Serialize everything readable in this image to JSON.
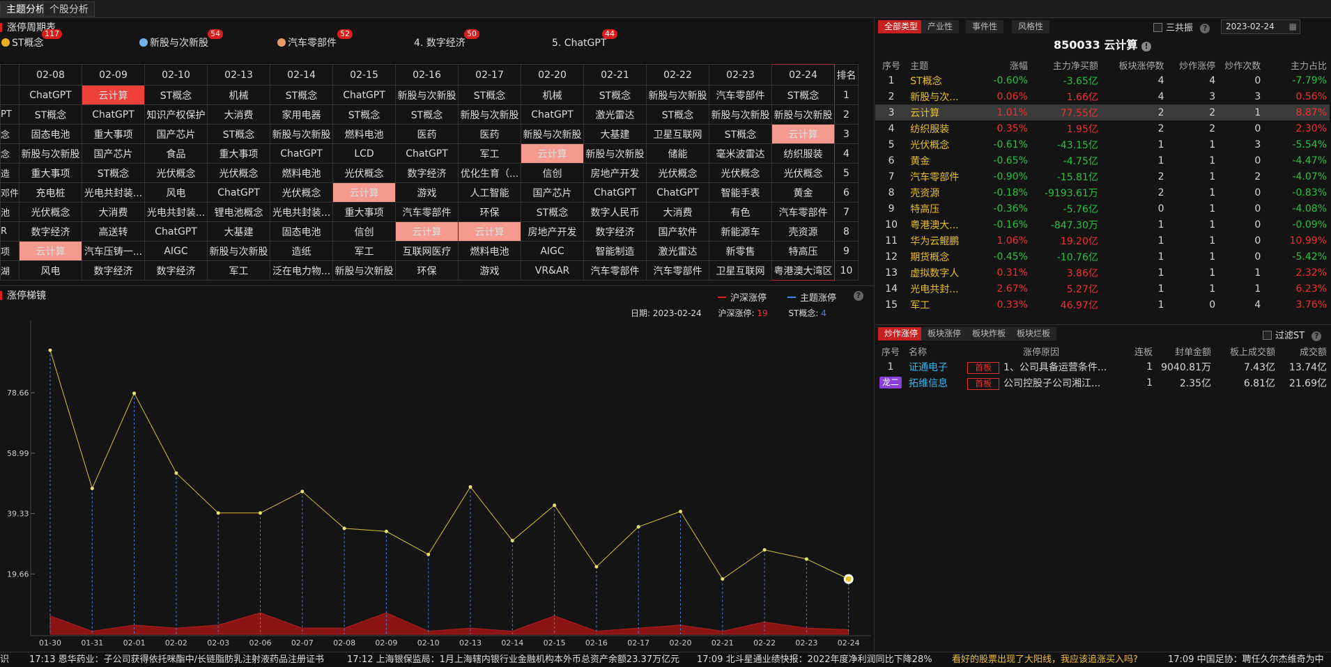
{
  "top_tabs": [
    "主题分析",
    "个股分析"
  ],
  "cycle_title": "涨停周期表",
  "categories": [
    {
      "label": "ST概念",
      "count": "117",
      "icon": "gold-cube-icon",
      "color": "#e8b020"
    },
    {
      "label": "新股与次新股",
      "count": "54",
      "icon": "blue-cube-icon",
      "color": "#7ab0e8"
    },
    {
      "label": "汽车零部件",
      "count": "52",
      "icon": "orange-cube-icon",
      "color": "#e89a6a"
    },
    {
      "label": "4. 数字经济",
      "count": "50"
    },
    {
      "label": "5. ChatGPT",
      "count": "44"
    }
  ],
  "grid": {
    "left_stub": [
      "PT",
      "念",
      "念",
      "造",
      "邓件",
      "池",
      "R",
      "项",
      "湖"
    ],
    "dates": [
      "02-08",
      "02-09",
      "02-10",
      "02-13",
      "02-14",
      "02-15",
      "02-16",
      "02-17",
      "02-20",
      "02-21",
      "02-22",
      "02-23",
      "02-24"
    ],
    "rank_label": "排名",
    "ranks": [
      "1",
      "2",
      "3",
      "4",
      "5",
      "6",
      "7",
      "8",
      "9",
      "10"
    ],
    "rows": [
      [
        "ChatGPT",
        "云计算",
        "ST概念",
        "机械",
        "ST概念",
        "ChatGPT",
        "新股与次新股",
        "ST概念",
        "机械",
        "ST概念",
        "新股与次新股",
        "汽车零部件",
        "ST概念"
      ],
      [
        "ST概念",
        "ChatGPT",
        "知识产权保护",
        "大消费",
        "家用电器",
        "ST概念",
        "ST概念",
        "新股与次新股",
        "ChatGPT",
        "激光雷达",
        "ST概念",
        "新股与次新股",
        "新股与次新股"
      ],
      [
        "固态电池",
        "重大事项",
        "国产芯片",
        "ST概念",
        "新股与次新股",
        "燃料电池",
        "医药",
        "医药",
        "新股与次新股",
        "大基建",
        "卫星互联网",
        "ST概念",
        "云计算"
      ],
      [
        "新股与次新股",
        "国产芯片",
        "食品",
        "重大事项",
        "ChatGPT",
        "LCD",
        "ChatGPT",
        "军工",
        "云计算",
        "新股与次新股",
        "储能",
        "毫米波雷达",
        "纺织服装"
      ],
      [
        "重大事项",
        "ST概念",
        "光伏概念",
        "光伏概念",
        "燃料电池",
        "光伏概念",
        "数字经济",
        "优化生育（...",
        "信创",
        "房地产开发",
        "光伏概念",
        "光伏概念",
        "光伏概念"
      ],
      [
        "充电桩",
        "光电共封装...",
        "风电",
        "ChatGPT",
        "光伏概念",
        "云计算",
        "游戏",
        "人工智能",
        "国产芯片",
        "ChatGPT",
        "ChatGPT",
        "智能手表",
        "黄金"
      ],
      [
        "光伏概念",
        "大消费",
        "光电共封装...",
        "锂电池概念",
        "光电共封装...",
        "重大事项",
        "汽车零部件",
        "环保",
        "ST概念",
        "数字人民币",
        "大消费",
        "有色",
        "汽车零部件"
      ],
      [
        "数字经济",
        "高送转",
        "ChatGPT",
        "大基建",
        "固态电池",
        "信创",
        "云计算",
        "云计算",
        "房地产开发",
        "数字经济",
        "国产软件",
        "新能源车",
        "壳资源"
      ],
      [
        "云计算",
        "汽车压铸一...",
        "AIGC",
        "新股与次新股",
        "造纸",
        "军工",
        "互联网医疗",
        "燃料电池",
        "AIGC",
        "智能制造",
        "激光雷达",
        "新零售",
        "特高压"
      ],
      [
        "风电",
        "数字经济",
        "数字经济",
        "军工",
        "泛在电力物...",
        "新股与次新股",
        "环保",
        "游戏",
        "VR&AR",
        "汽车零部件",
        "汽车零部件",
        "卫星互联网",
        "粤港澳大湾区"
      ]
    ],
    "highlights": [
      [
        0,
        1,
        "hl1"
      ],
      [
        2,
        12,
        "hl2"
      ],
      [
        3,
        8,
        "hl2"
      ],
      [
        5,
        5,
        "hl2"
      ],
      [
        7,
        6,
        "hl2"
      ],
      [
        7,
        7,
        "hl2"
      ],
      [
        8,
        0,
        "hl2"
      ]
    ]
  },
  "ladder": {
    "title": "涨停梯镜",
    "legend_a": "沪深涨停",
    "legend_b": "主题涨停",
    "color_a": "#e02020",
    "color_b": "#4a7ee0",
    "date_label": "日期:",
    "date_value": "2023-02-24",
    "hs_label": "沪深涨停:",
    "hs_value": "19",
    "st_label": "ST概念:",
    "st_value": "4"
  },
  "chart_data": {
    "type": "line",
    "x": [
      "01-30",
      "01-31",
      "02-01",
      "02-02",
      "02-03",
      "02-06",
      "02-07",
      "02-08",
      "02-09",
      "02-10",
      "02-13",
      "02-14",
      "02-15",
      "02-16",
      "02-17",
      "02-20",
      "02-21",
      "02-22",
      "02-23",
      "02-24"
    ],
    "y_ticks": [
      "78.66",
      "58.99",
      "39.33",
      "19.66"
    ],
    "ylim": [
      0,
      100
    ],
    "series": [
      {
        "values": [
          92.5,
          47.5,
          78.5,
          52.5,
          39.5,
          39.5,
          46.5,
          34.5,
          33.5,
          26,
          48,
          30.5,
          42,
          22,
          35,
          40,
          18,
          27.5,
          24.5,
          18
        ]
      },
      {
        "values": [
          6,
          1,
          3,
          2,
          3,
          7,
          2,
          2,
          7,
          1,
          2,
          1,
          6,
          1,
          2,
          3,
          1,
          4,
          2,
          1.5
        ]
      }
    ]
  },
  "right": {
    "tabs": [
      "全部类型",
      "产业性",
      "事件性",
      "风格性"
    ],
    "sangong_label": "三共振",
    "date_value": "2023-02-24",
    "heading": "850033 云计算",
    "headers": [
      "序号",
      "主题",
      "涨幅",
      "主力净买额",
      "板块涨停数",
      "炒作涨停",
      "炒作次数",
      "主力占比"
    ],
    "rows": [
      [
        "1",
        "ST概念",
        "-0.60%",
        "-3.65亿",
        "4",
        "4",
        "0",
        "-7.79%"
      ],
      [
        "2",
        "新股与次...",
        "0.06%",
        "1.66亿",
        "4",
        "3",
        "3",
        "0.56%"
      ],
      [
        "3",
        "云计算",
        "1.01%",
        "77.55亿",
        "2",
        "2",
        "1",
        "8.87%"
      ],
      [
        "4",
        "纺织服装",
        "0.35%",
        "1.95亿",
        "2",
        "2",
        "0",
        "2.30%"
      ],
      [
        "5",
        "光伏概念",
        "-0.61%",
        "-43.15亿",
        "1",
        "1",
        "3",
        "-5.54%"
      ],
      [
        "6",
        "黄金",
        "-0.65%",
        "-4.75亿",
        "1",
        "1",
        "0",
        "-4.47%"
      ],
      [
        "7",
        "汽车零部件",
        "-0.90%",
        "-15.81亿",
        "2",
        "1",
        "2",
        "-4.07%"
      ],
      [
        "8",
        "壳资源",
        "-0.18%",
        "-9193.61万",
        "2",
        "1",
        "0",
        "-0.83%"
      ],
      [
        "9",
        "特高压",
        "-0.36%",
        "-5.76亿",
        "0",
        "1",
        "0",
        "-4.08%"
      ],
      [
        "10",
        "粤港澳大...",
        "-0.16%",
        "-847.30万",
        "1",
        "1",
        "0",
        "-0.09%"
      ],
      [
        "11",
        "华为云鲲鹏",
        "1.06%",
        "19.20亿",
        "1",
        "1",
        "0",
        "10.99%"
      ],
      [
        "12",
        "期货概念",
        "-0.45%",
        "-10.76亿",
        "1",
        "1",
        "0",
        "-5.42%"
      ],
      [
        "13",
        "虚拟数字人",
        "0.31%",
        "3.86亿",
        "1",
        "1",
        "1",
        "2.32%"
      ],
      [
        "14",
        "光电共封...",
        "2.67%",
        "5.27亿",
        "1",
        "1",
        "1",
        "6.23%"
      ],
      [
        "15",
        "军工",
        "0.33%",
        "46.97亿",
        "1",
        "0",
        "4",
        "3.76%"
      ]
    ]
  },
  "limit": {
    "tabs": [
      "炒作涨停",
      "板块涨停",
      "板块炸板",
      "板块烂板"
    ],
    "filter_label": "过滤ST",
    "headers": [
      "序号",
      "名称",
      "涨停原因",
      "连板",
      "封单金额",
      "板上成交额",
      "成交额"
    ],
    "rows": [
      {
        "idx": "1",
        "name": "证通电子",
        "tag": "首板",
        "reason": "1、公司具备运营条件...",
        "lb": "1",
        "fd": "9040.81万",
        "bs": "7.43亿",
        "cj": "13.74亿"
      },
      {
        "idx": "龙二",
        "name": "拓维信息",
        "tag": "首板",
        "reason": "公司控股子公司湘江...",
        "lb": "1",
        "fd": "2.35亿",
        "bs": "6.81亿",
        "cj": "21.69亿"
      }
    ]
  },
  "ticker": [
    "识",
    "17:13 恩华药业：子公司获得依托咪酯中/长链脂肪乳注射液药品注册证书",
    "17:12 上海银保监局：1月上海辖内银行业金融机构本外币总资产余额23.37万亿元",
    "17:09 北斗星通业绩快报：2022年度净利润同比下降28%",
    "看好的股票出现了大阳线，我应该追涨买入吗?",
    "17:09 中国足协：聘任久尔杰维奇为中"
  ]
}
